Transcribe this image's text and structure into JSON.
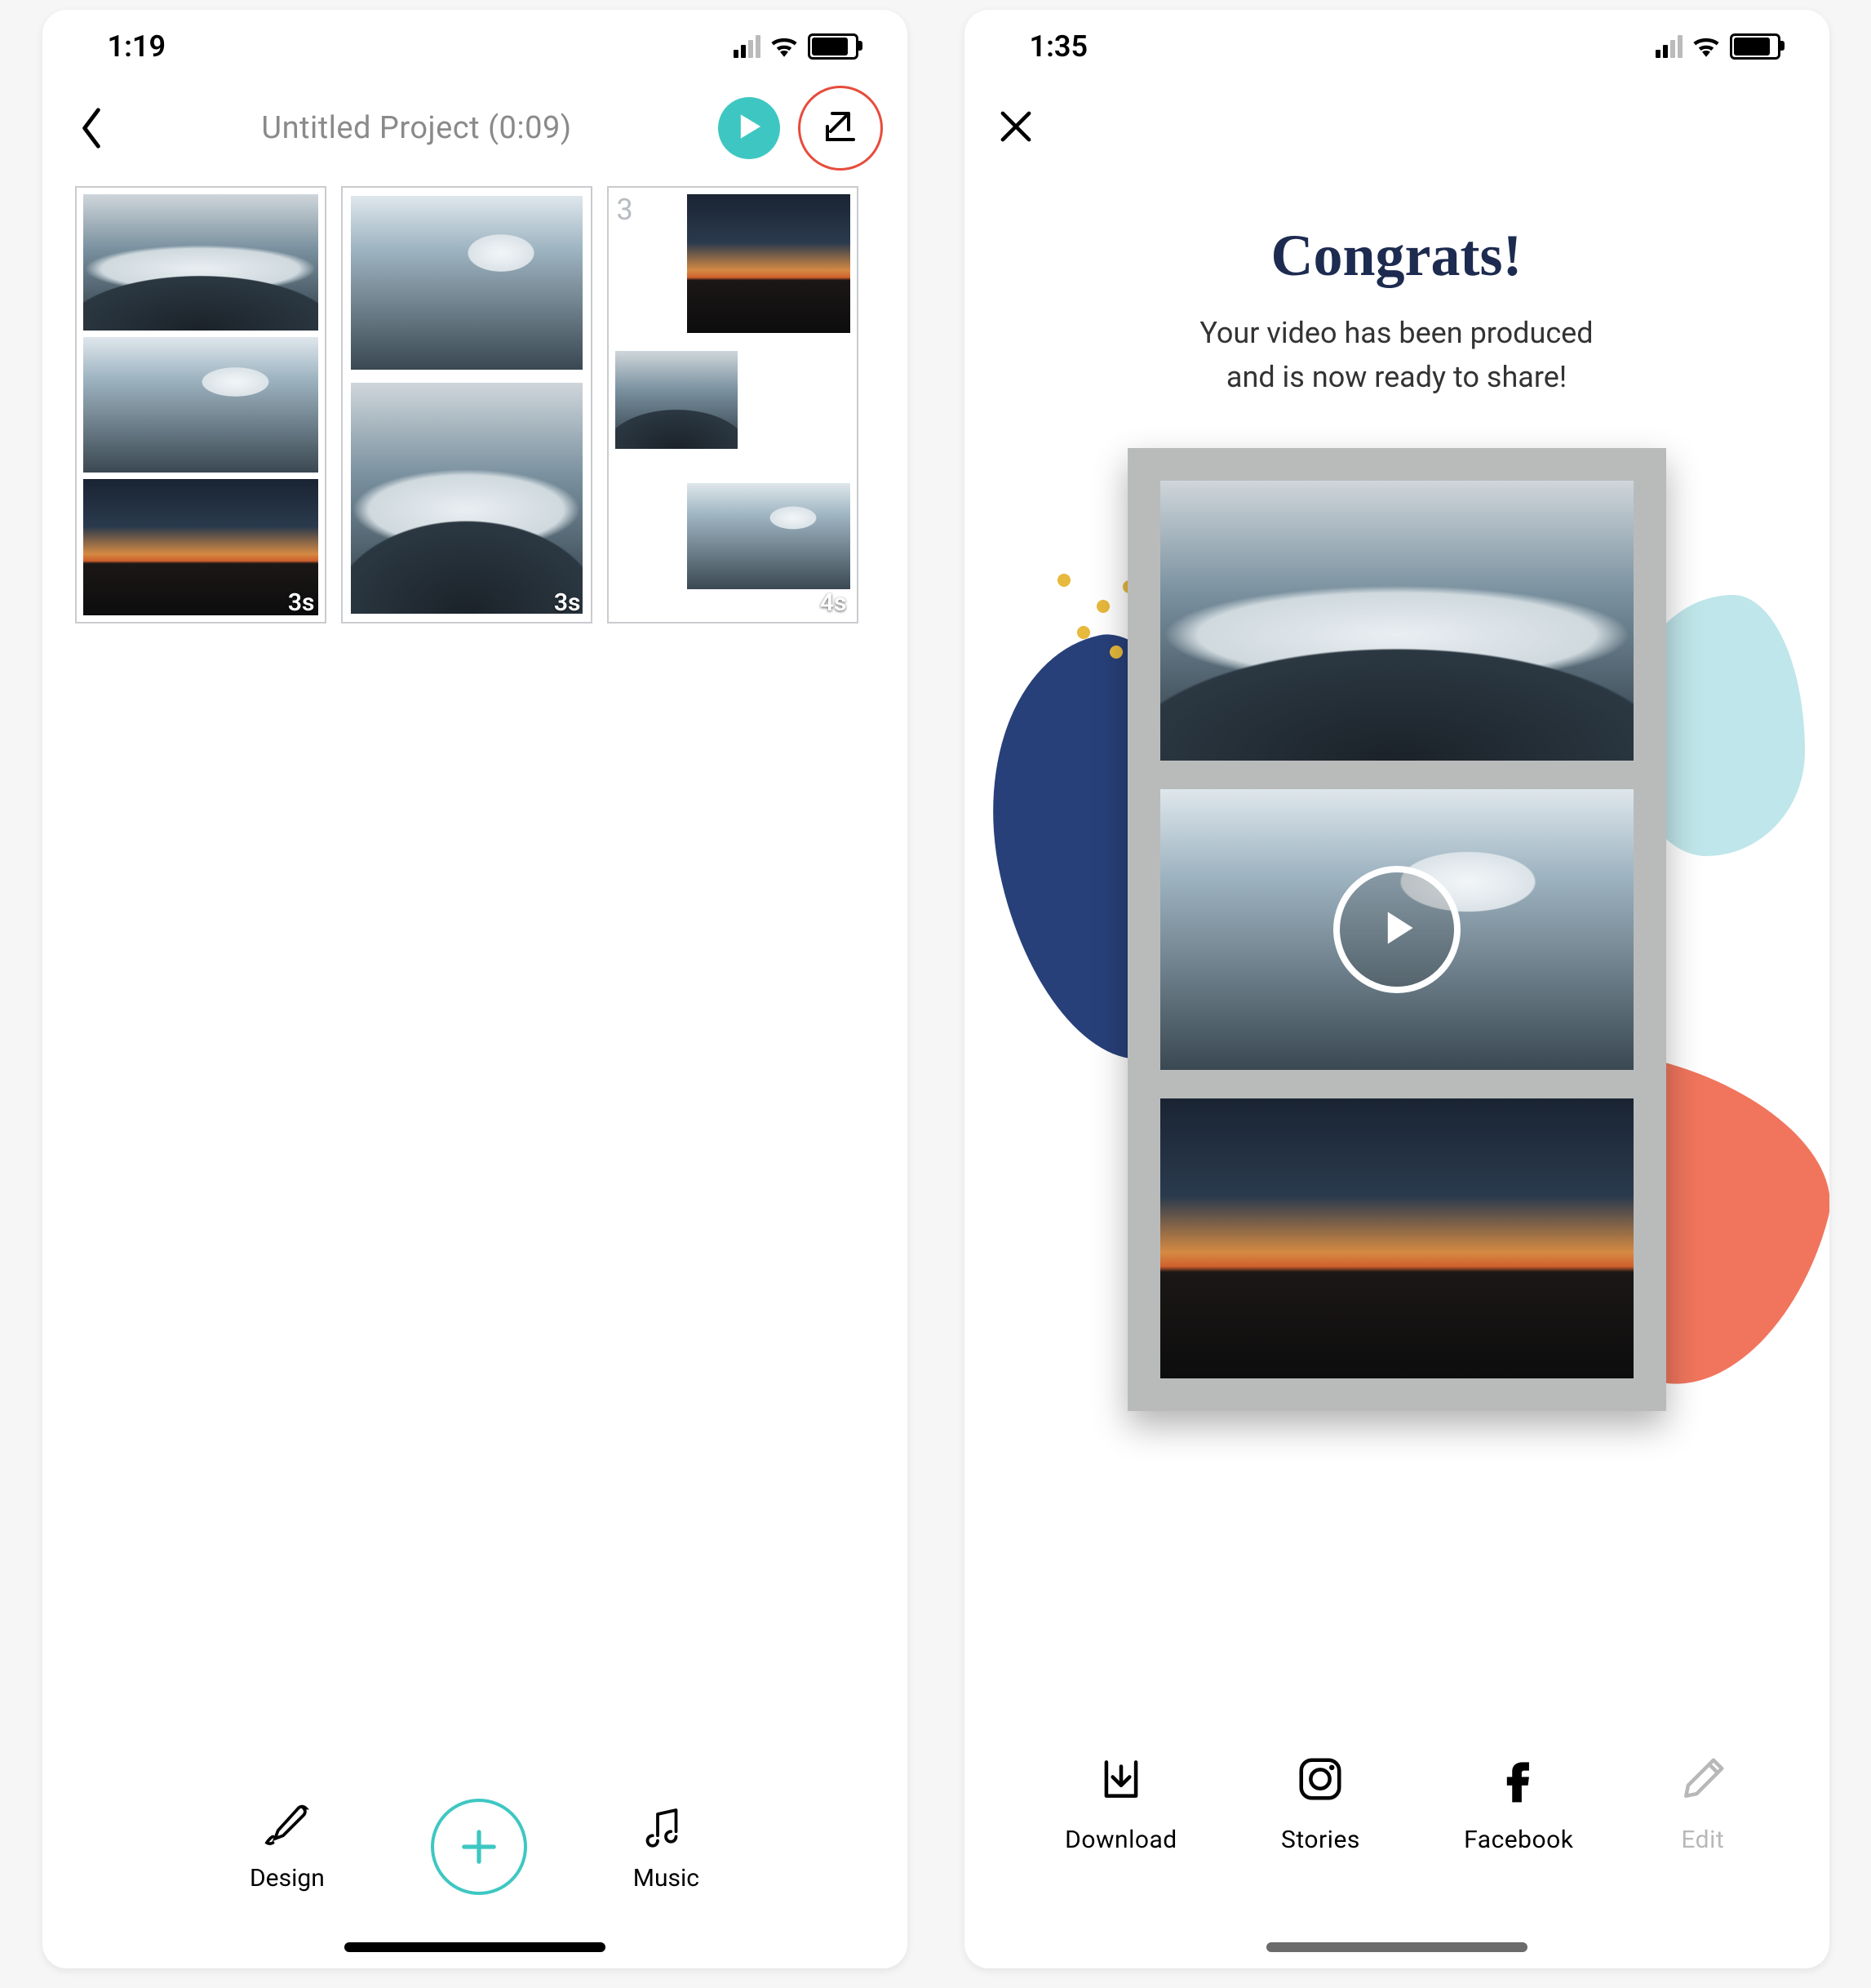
{
  "left": {
    "status_time": "1:19",
    "title": "Untitled Project (0:09)",
    "slides": [
      {
        "duration": "3s"
      },
      {
        "duration": "3s"
      },
      {
        "index_label": "3",
        "duration": "4s"
      }
    ],
    "bottom_bar": {
      "design": "Design",
      "music": "Music"
    }
  },
  "right": {
    "status_time": "1:35",
    "congrats_title": "Congrats!",
    "congrats_sub_line1": "Your video has been produced",
    "congrats_sub_line2": "and is now ready to share!",
    "share": {
      "download": "Download",
      "stories": "Stories",
      "facebook": "Facebook",
      "edit": "Edit"
    }
  }
}
